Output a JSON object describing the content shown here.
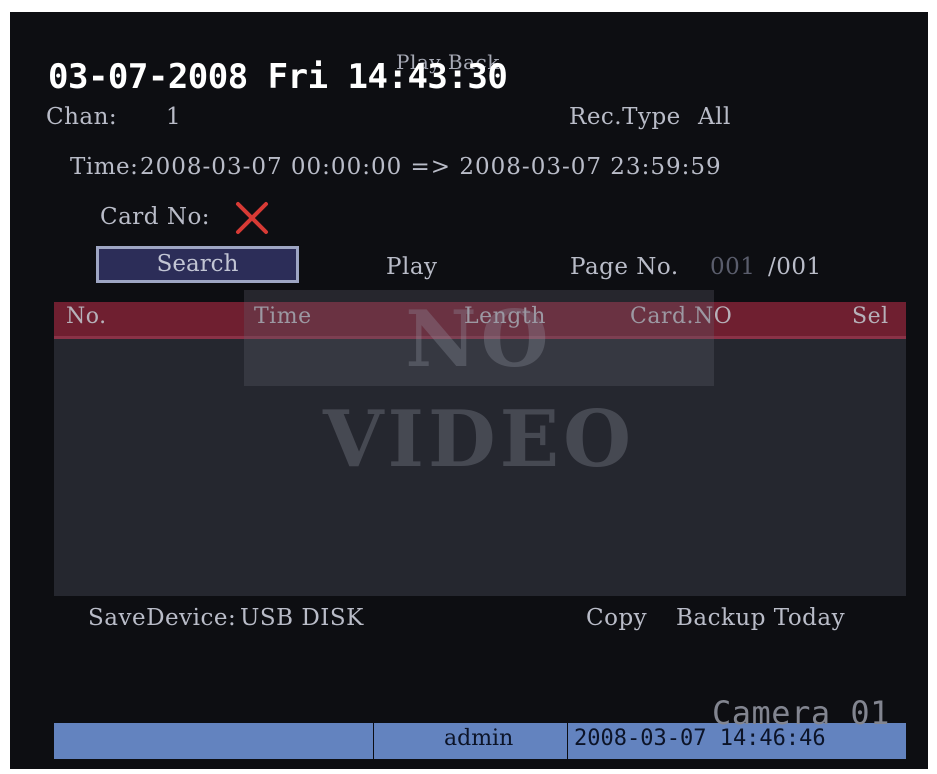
{
  "osd": {
    "datetime": "03-07-2008 Fri 14:43:30",
    "camera": "Camera 01"
  },
  "playback": {
    "title": "Play Back",
    "chan_label": "Chan:",
    "chan_value": "1",
    "rec_type_label": "Rec.Type",
    "rec_type_value": "All",
    "time_label": "Time:",
    "time_range": "2008-03-07 00:00:00 => 2008-03-07 23:59:59",
    "card_no_label": "Card No:",
    "card_no_icon": "x-icon",
    "search_label": "Search",
    "play_label": "Play",
    "page_label": "Page No.",
    "page_current": "001",
    "page_total": "/001"
  },
  "table": {
    "columns": [
      "No.",
      "Time",
      "Length",
      "Card.NO",
      "Sel"
    ],
    "rows": [],
    "overlay": "NO VIDEO"
  },
  "footer": {
    "save_device_label": "SaveDevice:",
    "save_device_value": "USB DISK",
    "copy_label": "Copy",
    "backup_today_label": "Backup Today"
  },
  "status_bar": {
    "user": "admin",
    "datetime": "2008-03-07 14:46:46"
  },
  "colors": {
    "screen_bg": "#0d0e12",
    "header_bg": "#6f1f30",
    "button_bg": "#2c2d58",
    "status_bar_bg": "#6383bf",
    "x_icon": "#d73a35"
  }
}
